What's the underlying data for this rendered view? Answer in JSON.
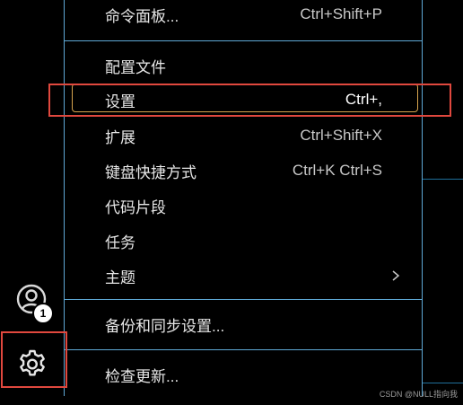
{
  "menu": {
    "items": [
      {
        "label": "命令面板...",
        "shortcut": "Ctrl+Shift+P"
      },
      {
        "label": "配置文件",
        "shortcut": ""
      },
      {
        "label": "设置",
        "shortcut": "Ctrl+,"
      },
      {
        "label": "扩展",
        "shortcut": "Ctrl+Shift+X"
      },
      {
        "label": "键盘快捷方式",
        "shortcut": "Ctrl+K Ctrl+S"
      },
      {
        "label": "代码片段",
        "shortcut": ""
      },
      {
        "label": "任务",
        "shortcut": ""
      },
      {
        "label": "主题",
        "shortcut": ""
      },
      {
        "label": "备份和同步设置...",
        "shortcut": ""
      },
      {
        "label": "检查更新...",
        "shortcut": ""
      }
    ],
    "active_item": "设置",
    "submenu_indicator_icon": "chevron-right-icon"
  },
  "activity_bar": {
    "accounts_icon": "account-icon",
    "accounts_badge": "1",
    "manage_icon": "gear-icon"
  },
  "watermark": "CSDN @NULL指向我",
  "colors": {
    "background": "#000000",
    "menu_border": "#5fa9d6",
    "focus_outline": "#d7a44e",
    "highlight_box": "#e0483e"
  }
}
